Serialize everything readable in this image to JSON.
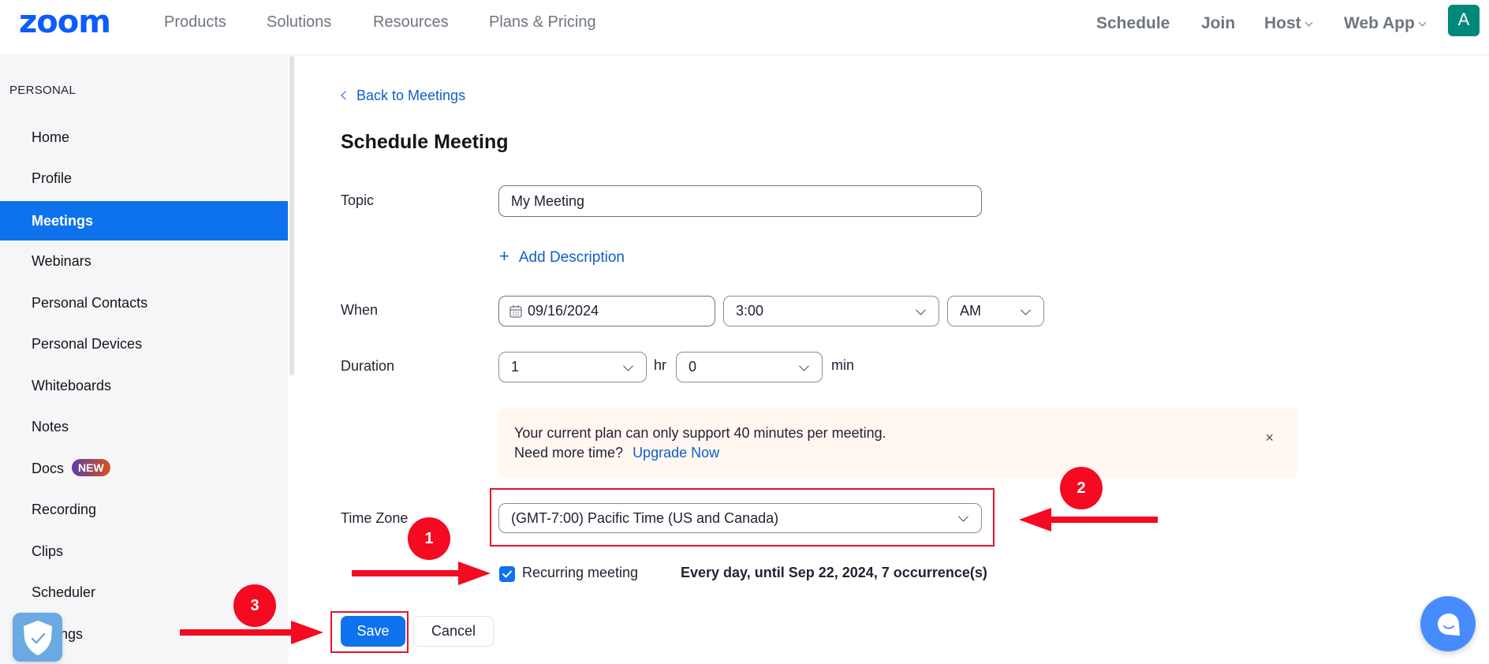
{
  "header": {
    "logo": "zoom",
    "nav_left": [
      "Products",
      "Solutions",
      "Resources",
      "Plans & Pricing"
    ],
    "nav_right": {
      "schedule": "Schedule",
      "join": "Join",
      "host": "Host",
      "web_app": "Web App"
    },
    "avatar_initial": "A",
    "avatar_color": "#00897b"
  },
  "sidebar": {
    "section": "PERSONAL",
    "items": [
      {
        "label": "Home"
      },
      {
        "label": "Profile"
      },
      {
        "label": "Meetings",
        "active": true
      },
      {
        "label": "Webinars"
      },
      {
        "label": "Personal Contacts"
      },
      {
        "label": "Personal Devices"
      },
      {
        "label": "Whiteboards"
      },
      {
        "label": "Notes"
      },
      {
        "label": "Docs",
        "badge": "NEW"
      },
      {
        "label": "Recording"
      },
      {
        "label": "Clips"
      },
      {
        "label": "Scheduler"
      },
      {
        "label": "Settings",
        "visible_label": "ngs"
      }
    ]
  },
  "main": {
    "back_link": "Back to Meetings",
    "title": "Schedule Meeting",
    "topic": {
      "label": "Topic",
      "value": "My Meeting"
    },
    "add_description": "Add Description",
    "when": {
      "label": "When",
      "date": "09/16/2024",
      "time": "3:00",
      "ampm": "AM"
    },
    "duration": {
      "label": "Duration",
      "hours": "1",
      "hours_unit": "hr",
      "minutes": "0",
      "minutes_unit": "min"
    },
    "banner": {
      "line1": "Your current plan can only support 40 minutes per meeting.",
      "line2": "Need more time?",
      "upgrade_link": "Upgrade Now",
      "close": "×"
    },
    "time_zone": {
      "label": "Time Zone",
      "value": "(GMT-7:00) Pacific Time (US and Canada)"
    },
    "recurring": {
      "label": "Recurring meeting",
      "checked": true,
      "summary": "Every day, until Sep 22, 2024, 7 occurrence(s)"
    },
    "save_button": "Save",
    "cancel_button": "Cancel"
  },
  "annotations": {
    "badge_1": "1",
    "badge_2": "2",
    "badge_3": "3",
    "color": "#f40a21"
  },
  "colors": {
    "brand": "#0b5cff",
    "primary": "#0e72ed",
    "link": "#0e5fc9"
  }
}
